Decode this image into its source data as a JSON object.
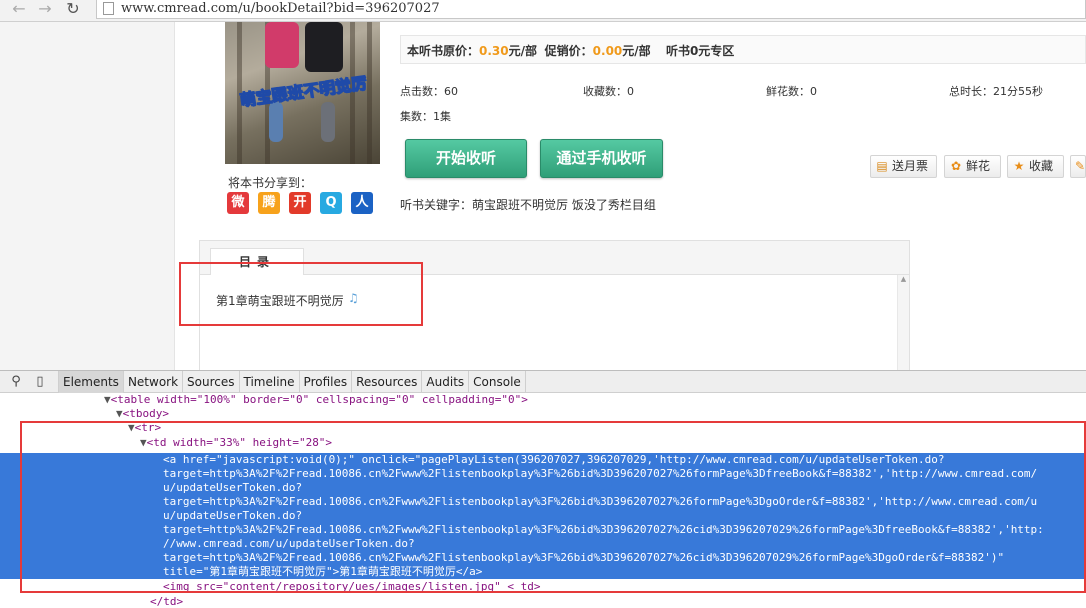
{
  "browser": {
    "url": "www.cmread.com/u/bookDetail?bid=396207027"
  },
  "price": {
    "original_label": "本听书原价：",
    "original_value": "0.30",
    "unit": "元/部",
    "sale_label": "促销价：",
    "sale_value": "0.00",
    "zone": "听书0元专区"
  },
  "stats": {
    "clicks": "点击数：60",
    "favorites": "收藏数：0",
    "flowers": "鲜花数：0",
    "duration": "总时长：21分55秒",
    "episodes": "集数：1集"
  },
  "cover": {
    "title": "萌宝跟班不明觉厉"
  },
  "actions": {
    "listen": "开始收听",
    "phone_listen": "通过手机收听",
    "ticket": "送月票",
    "flower": "鲜花",
    "favorite": "收藏"
  },
  "share": {
    "label": "将本书分享到：",
    "items": [
      "weibo",
      "tencent-weibo",
      "kaixin",
      "qzone",
      "renren"
    ],
    "glyphs": [
      "微",
      "腾",
      "开",
      "Q",
      "人"
    ],
    "colors": [
      "#e4393c",
      "#f7a21b",
      "#e23a2a",
      "#27a9e1",
      "#1b62c4"
    ]
  },
  "keywords": "听书关键字：萌宝跟班不明觉厉 饭没了秀栏目组",
  "toc": {
    "tab_label": "目录",
    "chapter": "第1章萌宝跟班不明觉厉"
  },
  "devtools": {
    "tabs": [
      "Elements",
      "Network",
      "Sources",
      "Timeline",
      "Profiles",
      "Resources",
      "Audits",
      "Console"
    ],
    "lines": {
      "table": "<table width=\"100%\" border=\"0\" cellspacing=\"0\" cellpadding=\"0\">",
      "tbody": "<tbody>",
      "tr": "<tr>",
      "td": "<td width=\"33%\" height=\"28\">",
      "a1": "<a href=\"javascript:void(0);\" onclick=\"pagePlayListen(396207027,396207029,'http://www.cmread.com/u/updateUserToken.do?",
      "a2": "target=http%3A%2F%2Fread.10086.cn%2Fwww%2Flistenbookplay%3F%26bid%3D396207027%26formPage%3DfreeBook&f=88382','http://www.cmread.com/",
      "a3": "u/updateUserToken.do?",
      "a4": "target=http%3A%2F%2Fread.10086.cn%2Fwww%2Flistenbookplay%3F%26bid%3D396207027%26formPage%3DgoOrder&f=88382','http://www.cmread.com/u",
      "a5": "u/updateUserToken.do?",
      "a6": "target=http%3A%2F%2Fread.10086.cn%2Fwww%2Flistenbookplay%3F%26bid%3D396207027%26cid%3D396207029%26formPage%3DfreeBook&f=88382','http:",
      "a7": "//www.cmread.com/u/updateUserToken.do?",
      "a8": "target=http%3A%2F%2Fread.10086.cn%2Fwww%2Flistenbookplay%3F%26bid%3D396207027%26cid%3D396207029%26formPage%3DgoOrder&f=88382')\"",
      "a9": "title=\"第1章萌宝跟班不明觉厉\">第1章萌宝跟班不明觉厉</a>",
      "img": "<img src=\"content/repository/ues/images/listen.jpg\" < td>",
      "td_close": "</td>"
    }
  }
}
